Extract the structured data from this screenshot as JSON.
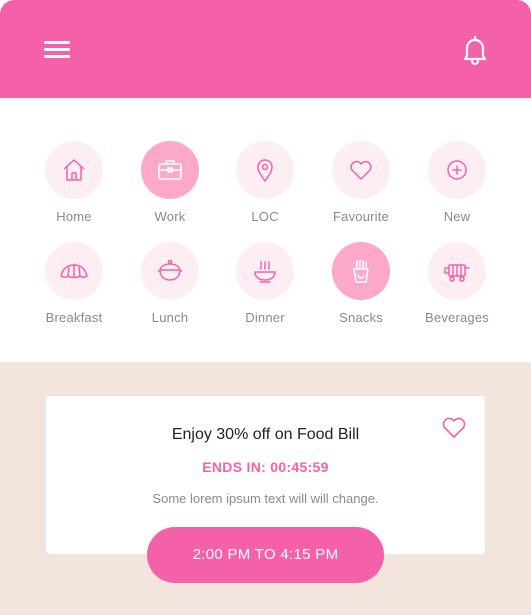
{
  "header": {
    "menu_icon": "hamburger-menu-icon",
    "bell_icon": "bell-icon",
    "accent_color": "#f561a9"
  },
  "categories": [
    {
      "label": "Home",
      "icon": "home-icon",
      "active": false
    },
    {
      "label": "Work",
      "icon": "briefcase-icon",
      "active": true
    },
    {
      "label": "LOC",
      "icon": "location-pin-icon",
      "active": false
    },
    {
      "label": "Favourite",
      "icon": "heart-icon",
      "active": false
    },
    {
      "label": "New",
      "icon": "plus-circle-icon",
      "active": false
    },
    {
      "label": "Breakfast",
      "icon": "croissant-icon",
      "active": false
    },
    {
      "label": "Lunch",
      "icon": "pot-icon",
      "active": false
    },
    {
      "label": "Dinner",
      "icon": "bowl-icon",
      "active": false
    },
    {
      "label": "Snacks",
      "icon": "fries-icon",
      "active": true
    },
    {
      "label": "Beverages",
      "icon": "drink-cart-icon",
      "active": false
    }
  ],
  "promo": {
    "title": "Enjoy 30% off on Food Bill",
    "timer": "ENDS IN: 00:45:59",
    "description": "Some lorem ipsum text will will change.",
    "favorite_icon": "heart-outline-icon",
    "time_range": "2:00 PM TO 4:15 PM"
  },
  "colors": {
    "accent": "#f561a9",
    "icon_circle": "#fdeef3",
    "icon_circle_active": "#fba8cb",
    "background": "#f3e4dd"
  }
}
